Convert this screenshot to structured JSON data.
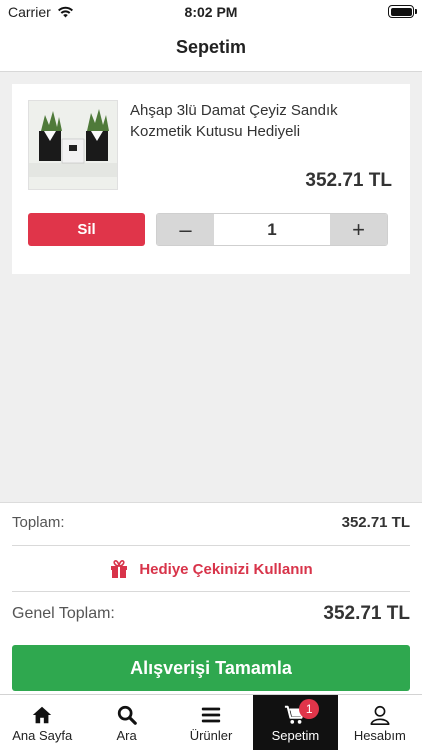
{
  "status_bar": {
    "carrier": "Carrier",
    "time": "8:02 PM"
  },
  "nav": {
    "title": "Sepetim"
  },
  "cart": {
    "items": [
      {
        "name": "Ahşap 3lü Damat Çeyiz Sandık Kozmetik Kutusu Hediyeli",
        "price": "352.71 TL",
        "delete_label": "Sil",
        "minus_label": "–",
        "quantity": "1",
        "plus_label": "+"
      }
    ]
  },
  "summary": {
    "subtotal_label": "Toplam:",
    "subtotal_value": "352.71 TL",
    "gift_label": "Hediye Çekinizi Kullanın",
    "grand_label": "Genel Toplam:",
    "grand_value": "352.71 TL",
    "checkout_label": "Alışverişi Tamamla"
  },
  "tabs": [
    {
      "label": "Ana Sayfa",
      "icon": "home-icon"
    },
    {
      "label": "Ara",
      "icon": "search-icon"
    },
    {
      "label": "Ürünler",
      "icon": "menu-icon"
    },
    {
      "label": "Sepetim",
      "icon": "cart-icon",
      "badge": "1",
      "active": true
    },
    {
      "label": "Hesabım",
      "icon": "user-icon"
    }
  ],
  "colors": {
    "danger": "#e0354a",
    "success": "#2fa84f",
    "active_tab": "#111111"
  }
}
